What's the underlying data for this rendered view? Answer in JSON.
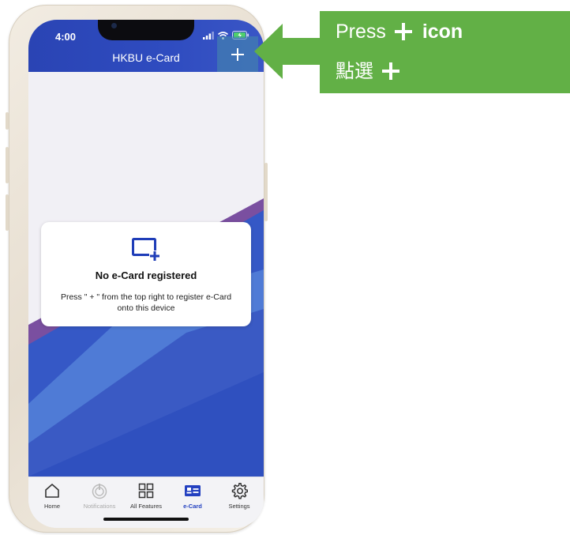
{
  "status_bar": {
    "time": "4:00"
  },
  "header": {
    "title": "HKBU e-Card"
  },
  "empty_state": {
    "title": "No e-Card registered",
    "description": "Press \" + \" from the top right to register e-Card onto this device"
  },
  "tabs": [
    {
      "label": "Home",
      "icon": "home-icon"
    },
    {
      "label": "Notifications",
      "icon": "bell-icon"
    },
    {
      "label": "All Features",
      "icon": "grid-icon"
    },
    {
      "label": "e-Card",
      "icon": "id-card-icon"
    },
    {
      "label": "Settings",
      "icon": "gear-icon"
    }
  ],
  "callout": {
    "line1_prefix": "Press",
    "line1_suffix": "icon",
    "line2_text": "點選"
  },
  "colors": {
    "header_blue": "#2f4cc0",
    "callout_green": "#62b046",
    "active_tab": "#2340c0"
  }
}
